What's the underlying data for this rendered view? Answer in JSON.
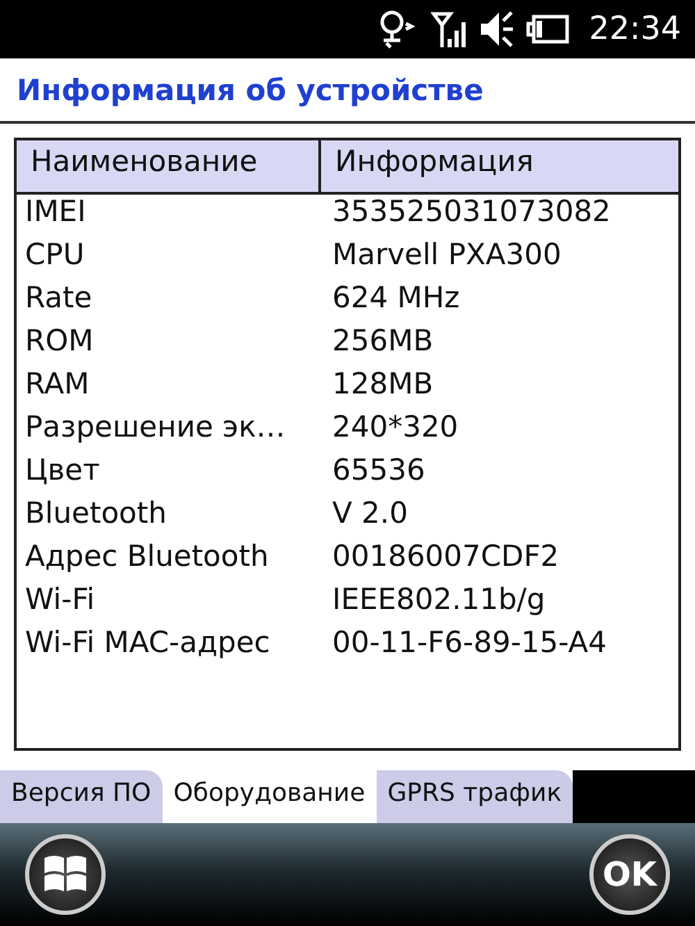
{
  "status_bar": {
    "time": "22:34"
  },
  "title": "Информация об устройстве",
  "table": {
    "columns": [
      "Наименование",
      "Информация"
    ],
    "rows": [
      [
        "IMEI",
        "353525031073082"
      ],
      [
        "CPU",
        "Marvell PXA300"
      ],
      [
        "Rate",
        "624 MHz"
      ],
      [
        "ROM",
        "256MB"
      ],
      [
        "RAM",
        "128MB"
      ],
      [
        "Разрешение эк…",
        "240*320"
      ],
      [
        "Цвет",
        "65536"
      ],
      [
        "Bluetooth",
        "V 2.0"
      ],
      [
        "Адрес Bluetooth",
        "00186007CDF2"
      ],
      [
        "Wi-Fi",
        "IEEE802.11b/g"
      ],
      [
        "Wi-Fi MAC-адрес",
        "00-11-F6-89-15-A4"
      ]
    ]
  },
  "tabs": [
    {
      "label": "Версия ПО",
      "selected": false
    },
    {
      "label": "Оборудование",
      "selected": true
    },
    {
      "label": "GPRS трафик",
      "selected": false
    }
  ],
  "softkeys": {
    "ok": "OK"
  }
}
